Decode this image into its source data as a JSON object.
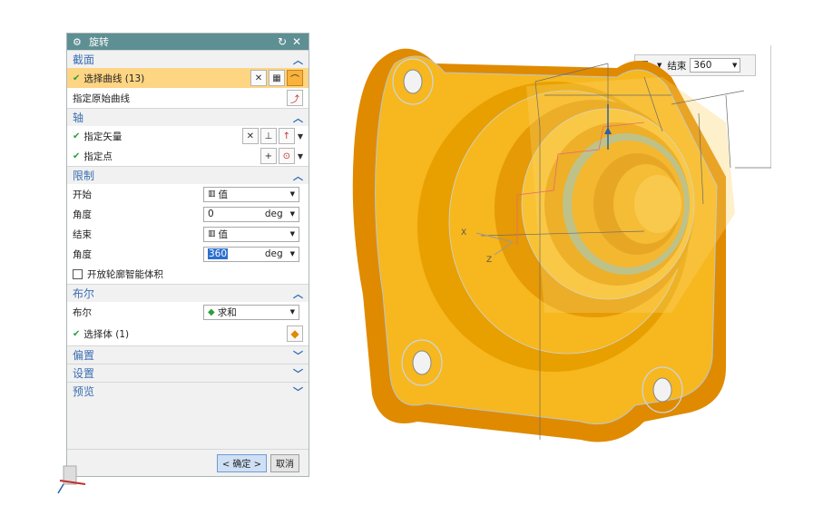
{
  "dialog": {
    "title": "旋转",
    "close_icon": "close-icon",
    "reset_icon": "reset-icon",
    "sections": {
      "section": {
        "label": "截面",
        "select_curve": "选择曲线 (13)",
        "specify_origin_curve": "指定原始曲线"
      },
      "axis": {
        "label": "轴",
        "specify_vector": "指定矢量",
        "specify_point": "指定点"
      },
      "limits": {
        "label": "限制",
        "start_label": "开始",
        "start_value": "值",
        "start_angle_label": "角度",
        "start_angle": "0",
        "start_unit": "deg",
        "end_label": "结束",
        "end_value": "值",
        "end_angle_label": "角度",
        "end_angle": "360",
        "end_unit": "deg",
        "open_profile_label": "开放轮廓智能体积"
      },
      "boolean": {
        "label": "布尔",
        "boolean_label": "布尔",
        "boolean_value": "求和",
        "select_body": "选择体 (1)"
      },
      "offset": {
        "label": "偏置"
      },
      "settings": {
        "label": "设置"
      },
      "preview": {
        "label": "预览"
      }
    },
    "ok_label": "< 确定 >",
    "cancel_label": "取消"
  },
  "floating_toolbar": {
    "end_label": "结束",
    "end_value": "360"
  },
  "viewport": {
    "axis_x_label": "X",
    "axis_z_label": "Z"
  },
  "colors": {
    "title_bar": "#5e8f93",
    "section_header_text": "#3a6fb2",
    "highlight_row": "#fdd583",
    "part_body": "#f5b21c",
    "part_shadow": "#e08a00"
  }
}
